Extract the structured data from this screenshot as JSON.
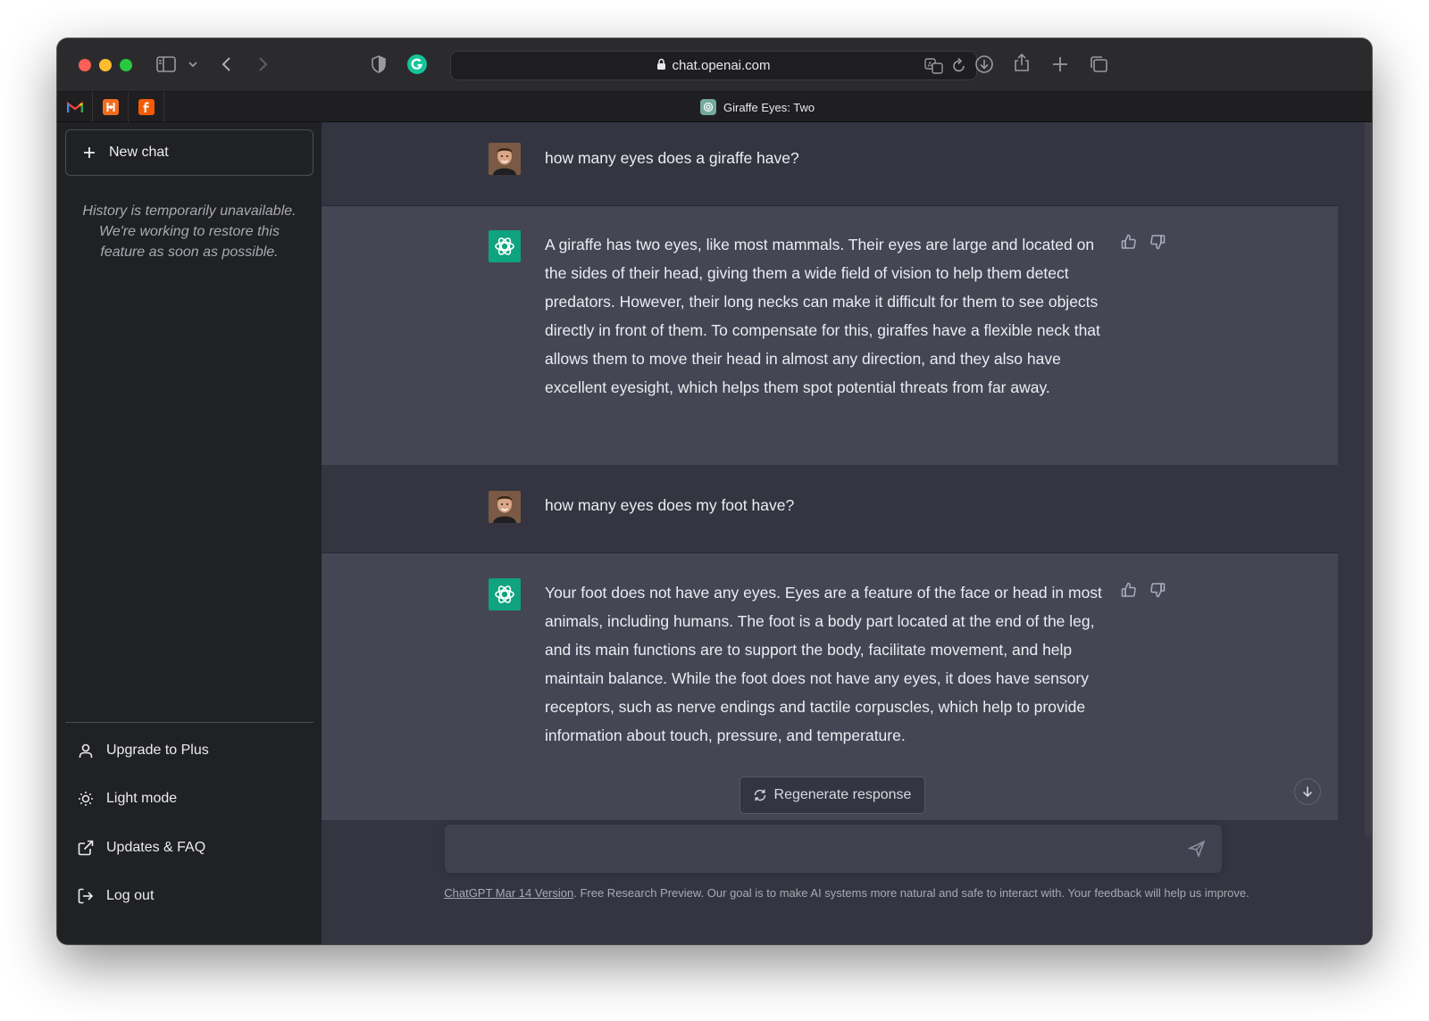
{
  "browser": {
    "url": "chat.openai.com",
    "tab_title": "Giraffe Eyes: Two",
    "pinned_tabs": [
      {
        "icon": "gmail-icon",
        "glyph": "M",
        "color": "#c5221f"
      },
      {
        "icon": "harvest-icon",
        "glyph": "H",
        "color": "#f36c21"
      },
      {
        "icon": "f-app-icon",
        "glyph": "f",
        "color": "#f25c05"
      }
    ]
  },
  "sidebar": {
    "new_chat": "New chat",
    "history_note": "History is temporarily unavailable. We're working to restore this feature as soon as possible.",
    "items": [
      {
        "label": "Upgrade to Plus",
        "icon": "user-icon"
      },
      {
        "label": "Light mode",
        "icon": "sun-icon"
      },
      {
        "label": "Updates & FAQ",
        "icon": "external-link-icon"
      },
      {
        "label": "Log out",
        "icon": "logout-icon"
      }
    ]
  },
  "conversation": [
    {
      "role": "user",
      "text": "how many eyes does a giraffe have?"
    },
    {
      "role": "assistant",
      "text": "A giraffe has two eyes, like most mammals. Their eyes are large and located on the sides of their head, giving them a wide field of vision to help them detect predators. However, their long necks can make it difficult for them to see objects directly in front of them. To compensate for this, giraffes have a flexible neck that allows them to move their head in almost any direction, and they also have excellent eyesight, which helps them spot potential threats from far away."
    },
    {
      "role": "user",
      "text": "how many eyes does my foot have?"
    },
    {
      "role": "assistant",
      "text": "Your foot does not have any eyes. Eyes are a feature of the face or head in most animals, including humans. The foot is a body part located at the end of the leg, and its main functions are to support the body, facilitate movement, and help maintain balance. While the foot does not have any eyes, it does have sensory receptors, such as nerve endings and tactile corpuscles, which help to provide information about touch, pressure, and temperature."
    }
  ],
  "composer": {
    "regenerate_label": "Regenerate response",
    "input_value": "",
    "footer_link": "ChatGPT Mar 14 Version",
    "footer_text": ". Free Research Preview. Our goal is to make AI systems more natural and safe to interact with. Your feedback will help us improve."
  },
  "colors": {
    "sidebar_bg": "#202123",
    "main_bg": "#343541",
    "assistant_bg": "#444654",
    "accent": "#10a37f"
  }
}
